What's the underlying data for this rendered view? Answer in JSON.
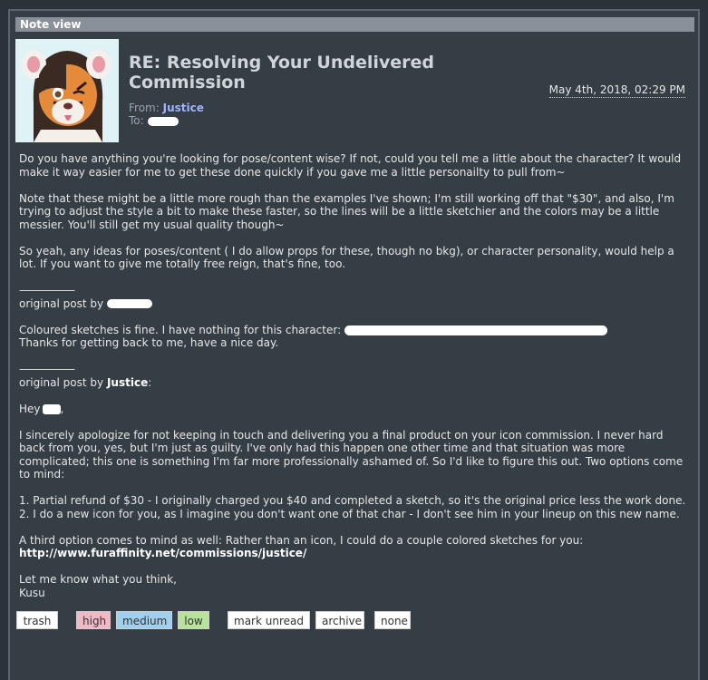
{
  "window": {
    "title": "Note view"
  },
  "note": {
    "subject": "RE: Resolving Your Undelivered Commission",
    "date": "May 4th, 2018, 02:29 PM",
    "from_label": "From:",
    "from_name": "Justice",
    "to_label": "To:",
    "body": {
      "p1": "Do you have anything you're looking for pose/content wise? If not, could you tell me a little about the character? It would make it way easier for me to get these done quickly if you gave me a little personailty to pull from~",
      "p2": "Note that these might be a little more rough than the examples I've shown; I'm still working off that \"$30\", and also, I'm trying to adjust the style a bit to make these faster, so the lines will be a little sketchier and the colors may be a little messier. You'll still get my usual quality though~",
      "p3": "So yeah, any ideas for poses/content ( I do allow props for these, though no bkg), or character personality, would help a lot. If you want to give me totally free reign, that's fine, too.",
      "divider": "——————",
      "orig_label": "original post by",
      "q1_line1": "Coloured sketches is fine. I have nothing for this character:",
      "q1_line2": "Thanks for getting back to me, have a nice day.",
      "orig_name2": "Justice",
      "orig_colon": ":",
      "hey": "Hey",
      "hey_comma": ",",
      "q2_p1": "I sincerely apologize for not keeping in touch and delivering you a final product on your icon commission. I never hard back from you, yes, but I'm just as guilty. I've only had this happen one other time and that situation was more complicated; this one is something I'm far more professionally ashamed of. So I'd like to figure this out. Two options come to mind:",
      "opt1": "1. Partial refund of $30 - I originally charged you $40 and completed a sketch, so it's the original price less the work done.",
      "opt2": "2. I do a new icon for you, as I imagine you don't want one of that char - I don't see him in your lineup on this new name.",
      "q2_p3": "A third option comes to mind as well: Rather than an icon, I could do a couple colored sketches for you:",
      "link": "http://www.furaffinity.net/commissions/justice/",
      "closing": "Let me know what you think,",
      "signature": "Kusu"
    }
  },
  "actions": {
    "trash": "trash",
    "high": "high",
    "medium": "medium",
    "low": "low",
    "mark_unread": "mark unread",
    "archive": "archive",
    "none": "none"
  }
}
